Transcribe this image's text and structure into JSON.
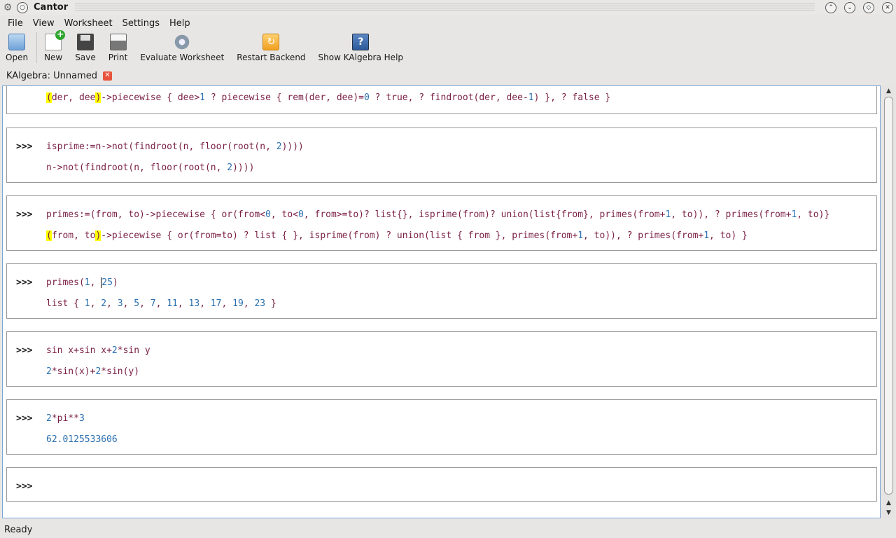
{
  "window": {
    "title": "Cantor"
  },
  "menu": [
    "File",
    "View",
    "Worksheet",
    "Settings",
    "Help"
  ],
  "toolbar": {
    "open": "Open",
    "new": "New",
    "save": "Save",
    "print": "Print",
    "evaluate": "Evaluate Worksheet",
    "restart": "Restart Backend",
    "help": "Show KAlgebra Help"
  },
  "tab": {
    "label": "KAlgebra: Unnamed"
  },
  "prompt": ">>>",
  "entries": [
    {
      "command": "",
      "result": "(der, dee)->piecewise { dee>1 ? piecewise { rem(der, dee)=0 ? true, ? findroot(der, dee-1) }, ? false }"
    },
    {
      "command": "isprime:=n->not(findroot(n, floor(root(n, 2))))",
      "result": "n->not(findroot(n, floor(root(n, 2))))"
    },
    {
      "command": "primes:=(from, to)->piecewise { or(from<0, to<0, from>=to)? list{}, isprime(from)? union(list{from}, primes(from+1, to)), ? primes(from+1, to)}",
      "result": "(from, to)->piecewise { or(from=to) ? list { }, isprime(from) ? union(list { from }, primes(from+1, to)), ? primes(from+1, to) }"
    },
    {
      "command": "primes(1, 25)",
      "result": "list { 1, 2, 3, 5, 7, 11, 13, 17, 19, 23 }"
    },
    {
      "command": "sin x+sin x+2*sin y",
      "result": "2*sin(x)+2*sin(y)"
    },
    {
      "command": "2*pi**3",
      "result": "62.0125533606"
    },
    {
      "command": "",
      "result": ""
    }
  ],
  "status": "Ready"
}
